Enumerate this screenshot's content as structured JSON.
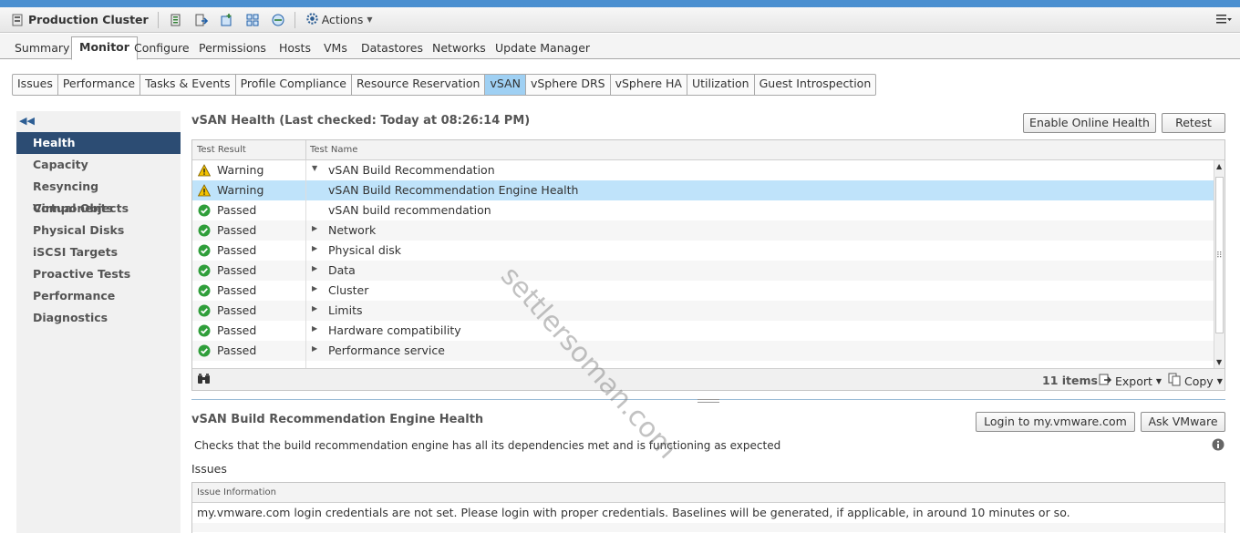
{
  "header": {
    "object_title": "Production Cluster",
    "actions_label": "Actions"
  },
  "main_tabs": [
    {
      "label": "Summary",
      "active": false
    },
    {
      "label": "Monitor",
      "active": true
    },
    {
      "label": "Configure",
      "active": false
    },
    {
      "label": "Permissions",
      "active": false
    },
    {
      "label": "Hosts",
      "active": false
    },
    {
      "label": "VMs",
      "active": false
    },
    {
      "label": "Datastores",
      "active": false
    },
    {
      "label": "Networks",
      "active": false
    },
    {
      "label": "Update Manager",
      "active": false
    }
  ],
  "sub_tabs": [
    {
      "label": "Issues"
    },
    {
      "label": "Performance"
    },
    {
      "label": "Tasks & Events"
    },
    {
      "label": "Profile Compliance"
    },
    {
      "label": "Resource Reservation"
    },
    {
      "label": "vSAN",
      "active": true
    },
    {
      "label": "vSphere DRS"
    },
    {
      "label": "vSphere HA"
    },
    {
      "label": "Utilization"
    },
    {
      "label": "Guest Introspection"
    }
  ],
  "sidebar": {
    "items": [
      {
        "label": "Health",
        "active": true
      },
      {
        "label": "Capacity"
      },
      {
        "label": "Resyncing Components"
      },
      {
        "label": "Virtual Objects"
      },
      {
        "label": "Physical Disks"
      },
      {
        "label": "iSCSI Targets"
      },
      {
        "label": "Proactive Tests"
      },
      {
        "label": "Performance Diagnostics"
      }
    ]
  },
  "health": {
    "title": "vSAN Health (Last checked: Today at 08:26:14 PM)",
    "enable_online_health_label": "Enable Online Health",
    "retest_label": "Retest",
    "columns": {
      "result": "Test Result",
      "name": "Test Name"
    },
    "rows": [
      {
        "status": "warning",
        "result": "Warning",
        "name": "vSAN Build Recommendation",
        "expander": "expanded",
        "indent": 0
      },
      {
        "status": "warning",
        "result": "Warning",
        "name": "vSAN Build Recommendation Engine Health",
        "expander": "none",
        "indent": 1,
        "selected": true
      },
      {
        "status": "passed",
        "result": "Passed",
        "name": "vSAN build recommendation",
        "expander": "none",
        "indent": 1
      },
      {
        "status": "passed",
        "result": "Passed",
        "name": "Network",
        "expander": "collapsed",
        "indent": 0
      },
      {
        "status": "passed",
        "result": "Passed",
        "name": "Physical disk",
        "expander": "collapsed",
        "indent": 0
      },
      {
        "status": "passed",
        "result": "Passed",
        "name": "Data",
        "expander": "collapsed",
        "indent": 0
      },
      {
        "status": "passed",
        "result": "Passed",
        "name": "Cluster",
        "expander": "collapsed",
        "indent": 0
      },
      {
        "status": "passed",
        "result": "Passed",
        "name": "Limits",
        "expander": "collapsed",
        "indent": 0
      },
      {
        "status": "passed",
        "result": "Passed",
        "name": "Hardware compatibility",
        "expander": "collapsed",
        "indent": 0
      },
      {
        "status": "passed",
        "result": "Passed",
        "name": "Performance service",
        "expander": "collapsed",
        "indent": 0
      }
    ],
    "items_count": "11 items",
    "export_label": "Export",
    "copy_label": "Copy"
  },
  "detail": {
    "title": "vSAN Build Recommendation Engine Health",
    "login_label": "Login to my.vmware.com",
    "ask_label": "Ask VMware",
    "description": "Checks that the build recommendation engine has all its dependencies met and is functioning as expected",
    "issues_label": "Issues",
    "issue_column": "Issue Information",
    "issue_text": "my.vmware.com login credentials are not set. Please login with proper credentials. Baselines will be generated, if applicable, in around 10 minutes or so."
  },
  "watermark": "settlersoman.com",
  "colors": {
    "selected_row": "#bfe3fa",
    "active_nav": "#2c4c73",
    "active_subtab": "#9fd0f3",
    "passed": "#2f9e3a",
    "warning": "#f3c300"
  }
}
